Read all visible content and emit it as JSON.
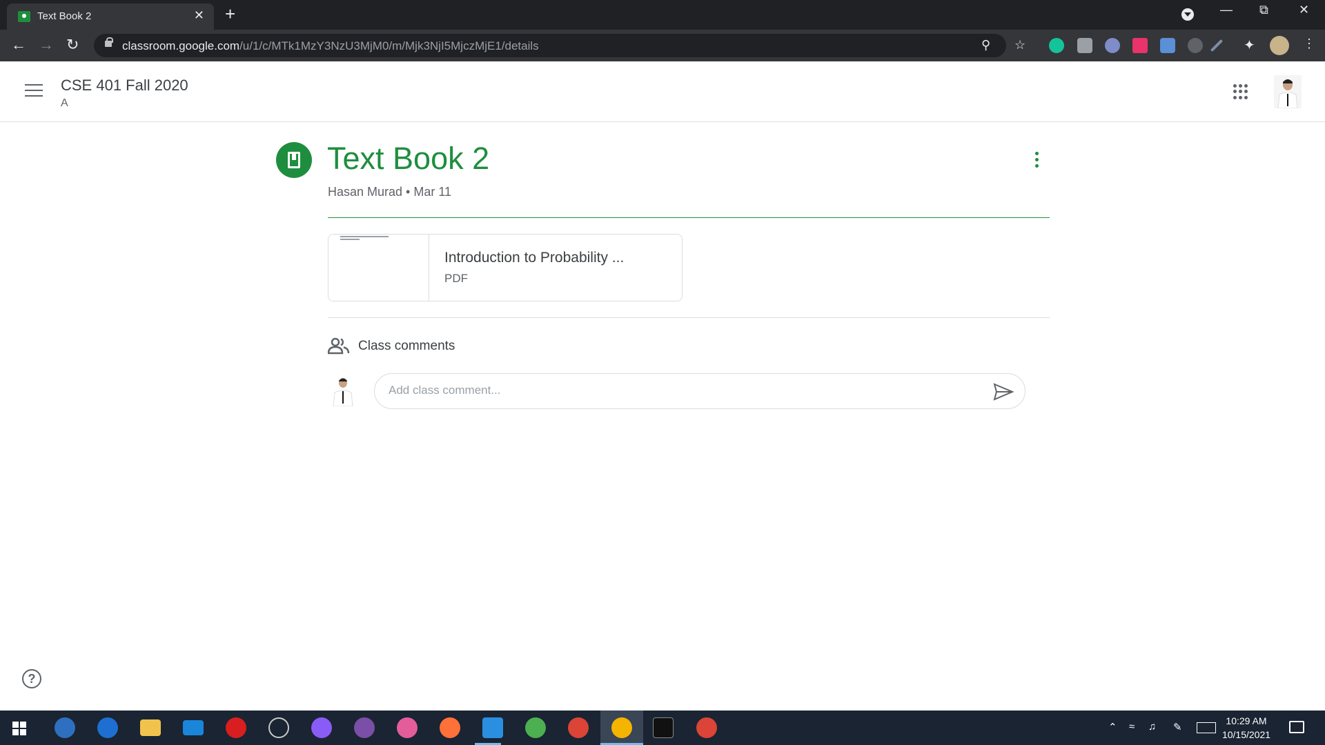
{
  "browser": {
    "tab_title": "Text Book 2",
    "tab_close": "✕",
    "new_tab": "+",
    "url_host": "classroom.google.com",
    "url_path": "/u/1/c/MTk1MzY3NzU3MjM0/m/Mjk3NjI5MjczMjE1/details"
  },
  "header": {
    "class_title": "CSE 401 Fall 2020",
    "class_section": "A"
  },
  "post": {
    "title": "Text Book 2",
    "meta": "Hasan Murad • Mar 11",
    "attachment": {
      "name": "Introduction to Probability ...",
      "type": "PDF"
    }
  },
  "comments": {
    "label": "Class comments",
    "placeholder": "Add class comment..."
  },
  "help": {
    "label": "?"
  },
  "taskbar": {
    "time": "10:29 AM",
    "date": "10/15/2021"
  },
  "colors": {
    "accent": "#1e8e3e",
    "taskbar": "#1a2433",
    "chrome_dark": "#202124"
  }
}
